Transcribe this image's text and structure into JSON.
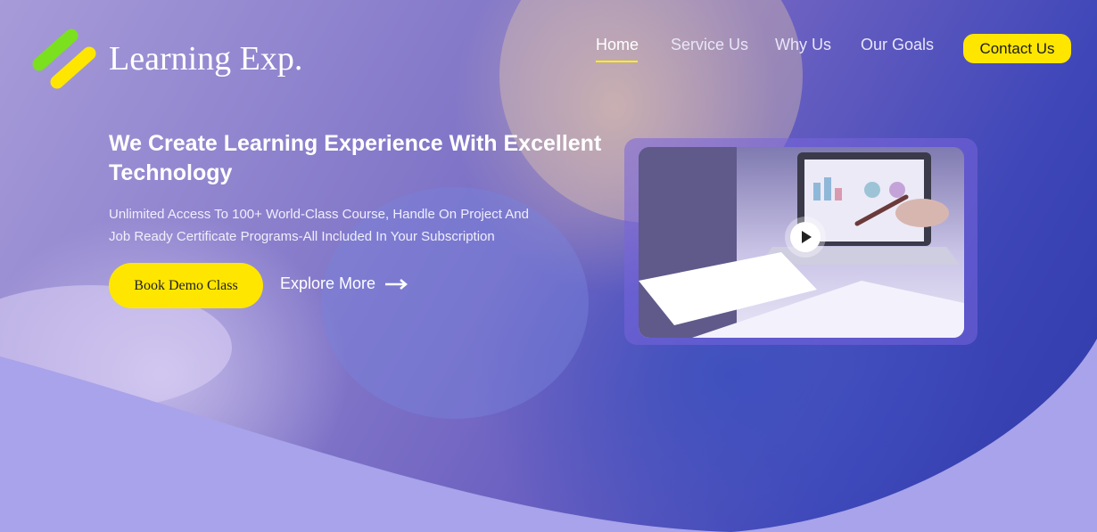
{
  "brand": {
    "name": "Learning Exp.",
    "logo_icon": "double-stripe-logo"
  },
  "nav": {
    "items": [
      {
        "label": "Home",
        "active": true
      },
      {
        "label": "Service Us",
        "active": false
      },
      {
        "label": "Why Us",
        "active": false
      },
      {
        "label": "Our Goals",
        "active": false
      }
    ],
    "contact_label": "Contact Us"
  },
  "hero": {
    "headline_line1": "We Create Learning Experience With Excellent",
    "headline_line2": "Technology",
    "subtitle_line1": "Unlimited Access To 100+ World-Class Course, Handle On Project And",
    "subtitle_line2": "Job Ready Certificate Programs-All Included In Your Subscription",
    "primary_cta": "Book Demo Class",
    "secondary_cta": "Explore More",
    "video_icon": "play-icon"
  },
  "colors": {
    "accent_yellow": "#ffe600",
    "logo_green": "#7be01d",
    "hero_overlay": "#7b73c9",
    "curve_fill": "#a8a3ea"
  }
}
